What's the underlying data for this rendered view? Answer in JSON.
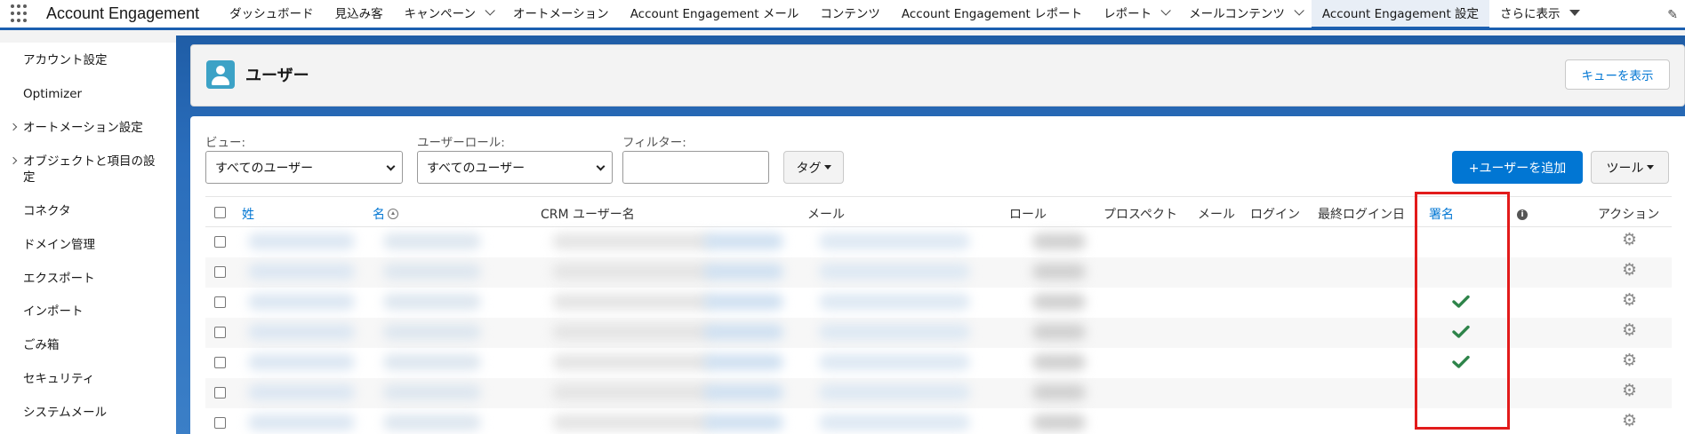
{
  "topnav": {
    "app_name": "Account Engagement",
    "items": [
      {
        "label": "ダッシュボード",
        "dropdown": false
      },
      {
        "label": "見込み客",
        "dropdown": false
      },
      {
        "label": "キャンペーン",
        "dropdown": true
      },
      {
        "label": "オートメーション",
        "dropdown": false
      },
      {
        "label": "Account Engagement メール",
        "dropdown": false
      },
      {
        "label": "コンテンツ",
        "dropdown": false
      },
      {
        "label": "Account Engagement レポート",
        "dropdown": false
      },
      {
        "label": "レポート",
        "dropdown": true
      },
      {
        "label": "メールコンテンツ",
        "dropdown": true
      },
      {
        "label": "Account Engagement 設定",
        "dropdown": false,
        "active": true
      },
      {
        "label": "さらに表示",
        "dropdown": "caret"
      }
    ]
  },
  "sidebar": {
    "items": [
      {
        "label": "アカウント設定",
        "expandable": false
      },
      {
        "label": "Optimizer",
        "expandable": false
      },
      {
        "label": "オートメーション設定",
        "expandable": true
      },
      {
        "label": "オブジェクトと項目の設定",
        "expandable": true
      },
      {
        "label": "コネクタ",
        "expandable": false
      },
      {
        "label": "ドメイン管理",
        "expandable": false
      },
      {
        "label": "エクスポート",
        "expandable": false
      },
      {
        "label": "インポート",
        "expandable": false
      },
      {
        "label": "ごみ箱",
        "expandable": false
      },
      {
        "label": "セキュリティ",
        "expandable": false
      },
      {
        "label": "システムメール",
        "expandable": false
      }
    ]
  },
  "header": {
    "title": "ユーザー",
    "queue_button": "キューを表示"
  },
  "filters": {
    "view_label": "ビュー:",
    "view_value": "すべてのユーザー",
    "role_label": "ユーザーロール:",
    "role_value": "すべてのユーザー",
    "filter_label": "フィルター:",
    "filter_value": "",
    "tag_button": "タグ",
    "add_user_button": "+ユーザーを追加",
    "tools_button": "ツール"
  },
  "table": {
    "columns": {
      "last_name": "姓",
      "first_name": "名",
      "crm_user": "CRM ユーザー名",
      "email": "メール",
      "role": "ロール",
      "prospect": "プロスペクト",
      "mail": "メール",
      "login": "ログイン",
      "last_login": "最終ログイン日",
      "signature": "署名",
      "action": "アクション"
    },
    "rows": [
      {
        "signature": false
      },
      {
        "signature": false
      },
      {
        "signature": true
      },
      {
        "signature": true
      },
      {
        "signature": true
      },
      {
        "signature": false
      },
      {
        "signature": false
      }
    ]
  },
  "colors": {
    "brand_blue": "#0176d3",
    "check_green": "#2e844a",
    "highlight_red": "#e21b1b"
  }
}
